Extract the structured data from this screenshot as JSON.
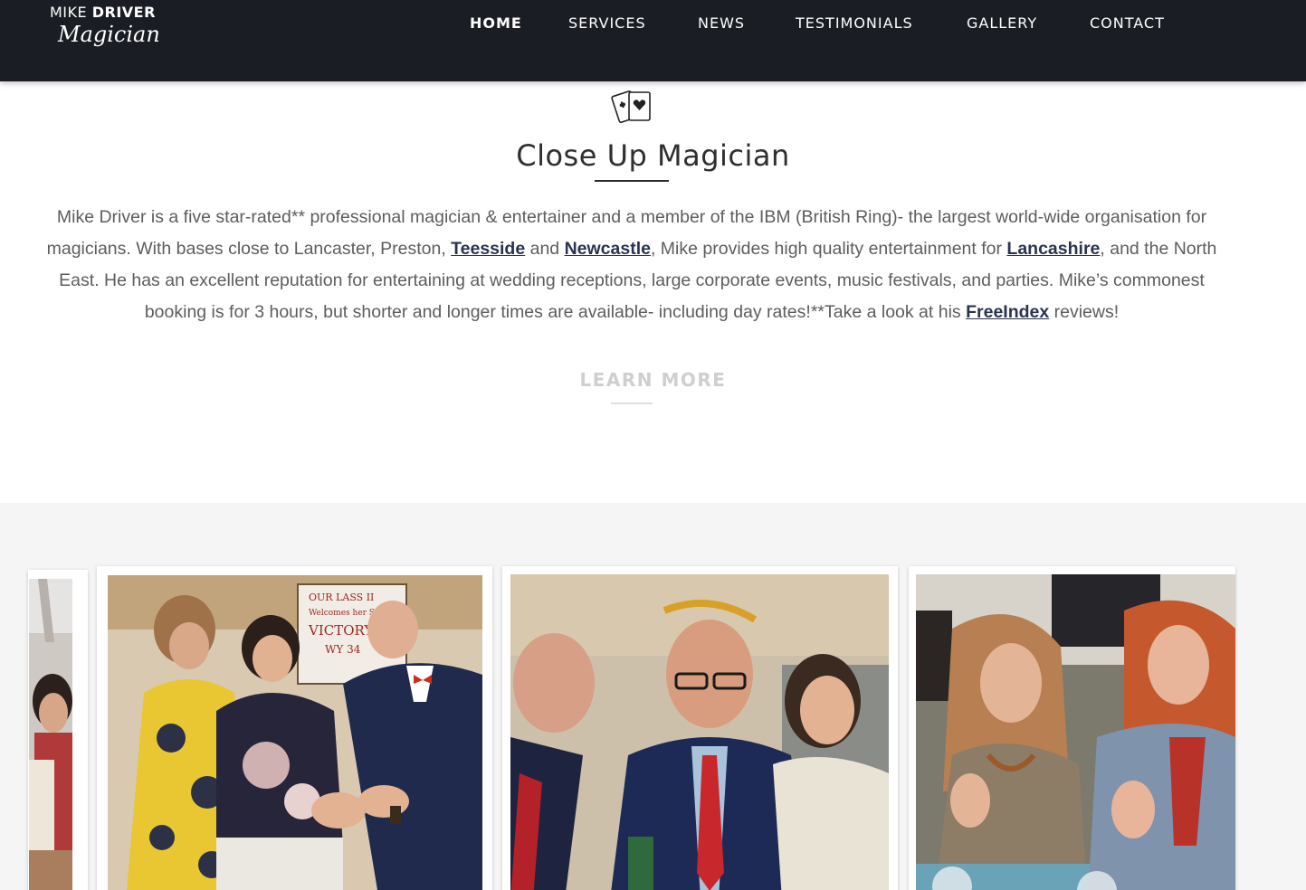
{
  "brand": {
    "name_light": "MIKE",
    "name_bold": "DRIVER",
    "script": "Magician"
  },
  "nav": {
    "items": [
      {
        "label": "HOME",
        "active": true
      },
      {
        "label": "SERVICES"
      },
      {
        "label": "NEWS"
      },
      {
        "label": "TESTIMONIALS"
      },
      {
        "label": "GALLERY"
      },
      {
        "label": "CONTACT"
      }
    ]
  },
  "intro": {
    "icon": "playing-cards-icon",
    "title": "Close Up Magician",
    "desc_part1": "Mike Driver is a five star-rated** professional magician & entertainer and a member of the IBM (British Ring)- the largest world-wide organisation for magicians. With bases close to Lancaster, Preston, ",
    "link_teesside": "Teesside",
    "desc_part2": " and ",
    "link_newcastle": "Newcastle",
    "desc_part3": ", Mike provides high quality entertainment for ",
    "link_lancashire": "Lancashire",
    "desc_part4": ", and the North East. He has an excellent reputation for entertaining  at wedding receptions, large corporate events, music festivals, and parties. Mike’s commonest booking is for 3 hours, but shorter and longer times are available- including day rates!**Take a look at his ",
    "link_freeindex": "FreeIndex",
    "desc_part5": " reviews!",
    "learn_more": "LEARN MORE"
  },
  "gallery": {
    "photos": [
      {
        "subject": "wedding guest at reception"
      },
      {
        "subject": "magician performing trick for two women at boat event",
        "sign_line1": "OUR LASS II",
        "sign_line2": "Welcomes her Sister",
        "sign_line3": "VICTORY RO",
        "sign_line4": "WY 34"
      },
      {
        "subject": "magician with guests at marquee event"
      },
      {
        "subject": "women applauding at music festival"
      }
    ]
  },
  "colors": {
    "header_bg": "#1b1d25",
    "link": "#2a3350",
    "gallery_bg": "#f5f5f5",
    "learn_more": "#cfcfcf"
  }
}
